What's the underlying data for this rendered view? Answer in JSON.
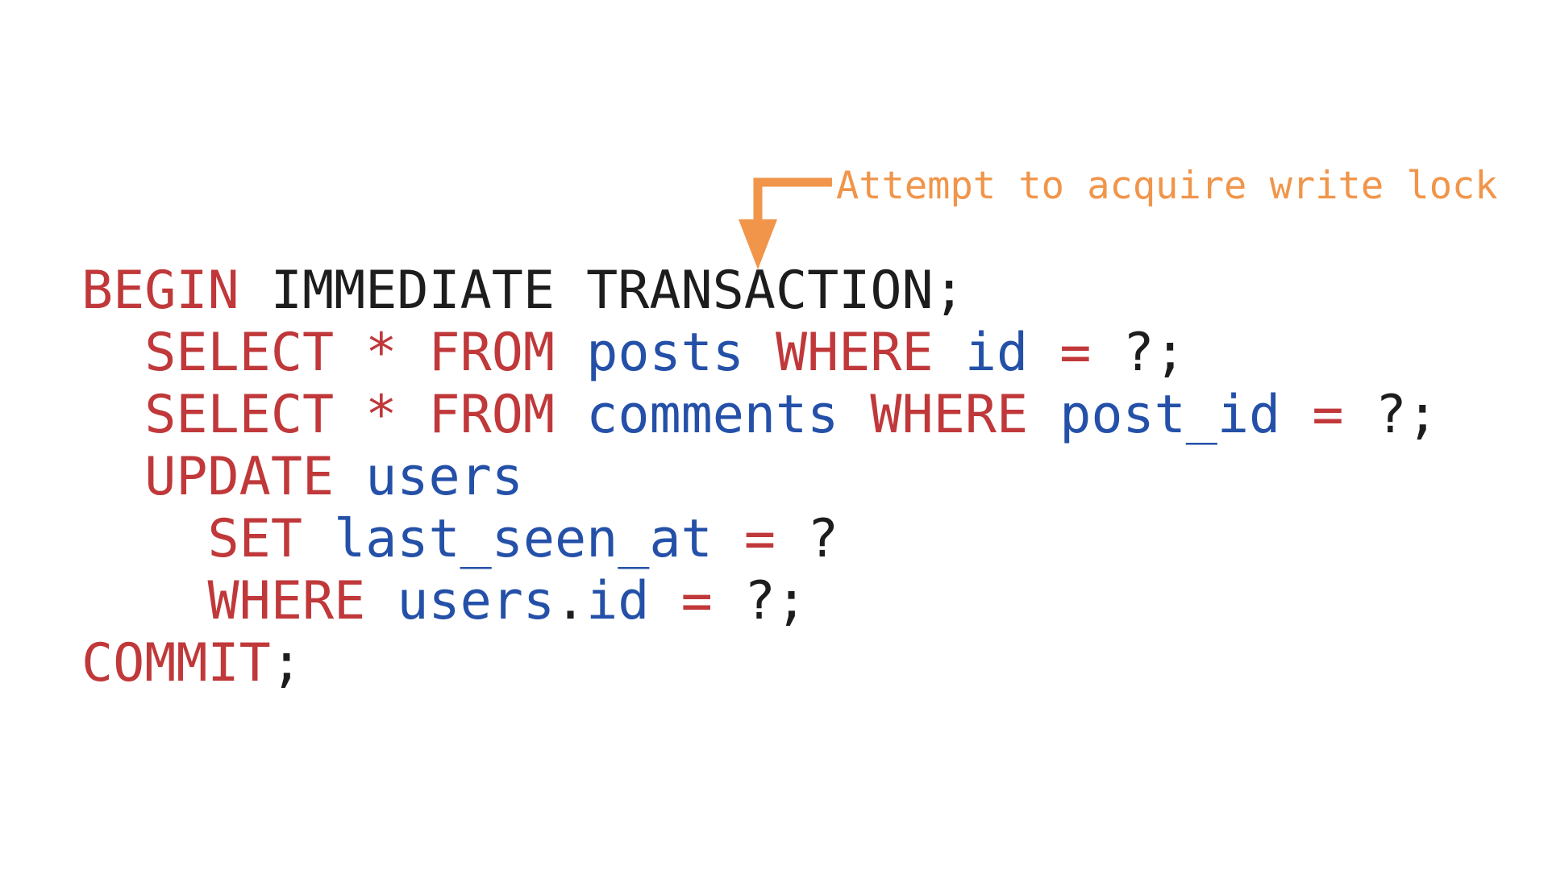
{
  "annotation": {
    "label": "Attempt to acquire write lock",
    "color": "#f0954a"
  },
  "colors": {
    "keyword": "#c0383a",
    "identifier": "#2450a8",
    "plain": "#1d1d1d"
  },
  "code": {
    "lines": [
      {
        "indent": "",
        "tokens": [
          {
            "text": "BEGIN",
            "kind": "keyword"
          },
          {
            "text": " IMMEDIATE TRANSACTION;",
            "kind": "plain"
          }
        ]
      },
      {
        "indent": "  ",
        "tokens": [
          {
            "text": "SELECT",
            "kind": "keyword"
          },
          {
            "text": " ",
            "kind": "plain"
          },
          {
            "text": "*",
            "kind": "keyword"
          },
          {
            "text": " ",
            "kind": "plain"
          },
          {
            "text": "FROM",
            "kind": "keyword"
          },
          {
            "text": " ",
            "kind": "plain"
          },
          {
            "text": "posts",
            "kind": "ident"
          },
          {
            "text": " ",
            "kind": "plain"
          },
          {
            "text": "WHERE",
            "kind": "keyword"
          },
          {
            "text": " ",
            "kind": "plain"
          },
          {
            "text": "id",
            "kind": "ident"
          },
          {
            "text": " ",
            "kind": "plain"
          },
          {
            "text": "=",
            "kind": "keyword"
          },
          {
            "text": " ?;",
            "kind": "plain"
          }
        ]
      },
      {
        "indent": "  ",
        "tokens": [
          {
            "text": "SELECT",
            "kind": "keyword"
          },
          {
            "text": " ",
            "kind": "plain"
          },
          {
            "text": "*",
            "kind": "keyword"
          },
          {
            "text": " ",
            "kind": "plain"
          },
          {
            "text": "FROM",
            "kind": "keyword"
          },
          {
            "text": " ",
            "kind": "plain"
          },
          {
            "text": "comments",
            "kind": "ident"
          },
          {
            "text": " ",
            "kind": "plain"
          },
          {
            "text": "WHERE",
            "kind": "keyword"
          },
          {
            "text": " ",
            "kind": "plain"
          },
          {
            "text": "post_id",
            "kind": "ident"
          },
          {
            "text": " ",
            "kind": "plain"
          },
          {
            "text": "=",
            "kind": "keyword"
          },
          {
            "text": " ?;",
            "kind": "plain"
          }
        ]
      },
      {
        "indent": "  ",
        "tokens": [
          {
            "text": "UPDATE",
            "kind": "keyword"
          },
          {
            "text": " ",
            "kind": "plain"
          },
          {
            "text": "users",
            "kind": "ident"
          }
        ]
      },
      {
        "indent": "    ",
        "tokens": [
          {
            "text": "SET",
            "kind": "keyword"
          },
          {
            "text": " ",
            "kind": "plain"
          },
          {
            "text": "last_seen_at",
            "kind": "ident"
          },
          {
            "text": " ",
            "kind": "plain"
          },
          {
            "text": "=",
            "kind": "keyword"
          },
          {
            "text": " ?",
            "kind": "plain"
          }
        ]
      },
      {
        "indent": "    ",
        "tokens": [
          {
            "text": "WHERE",
            "kind": "keyword"
          },
          {
            "text": " ",
            "kind": "plain"
          },
          {
            "text": "users",
            "kind": "ident"
          },
          {
            "text": ".",
            "kind": "plain"
          },
          {
            "text": "id",
            "kind": "ident"
          },
          {
            "text": " ",
            "kind": "plain"
          },
          {
            "text": "=",
            "kind": "keyword"
          },
          {
            "text": " ?;",
            "kind": "plain"
          }
        ]
      },
      {
        "indent": "",
        "tokens": [
          {
            "text": "COMMIT",
            "kind": "keyword"
          },
          {
            "text": ";",
            "kind": "plain"
          }
        ]
      }
    ]
  }
}
